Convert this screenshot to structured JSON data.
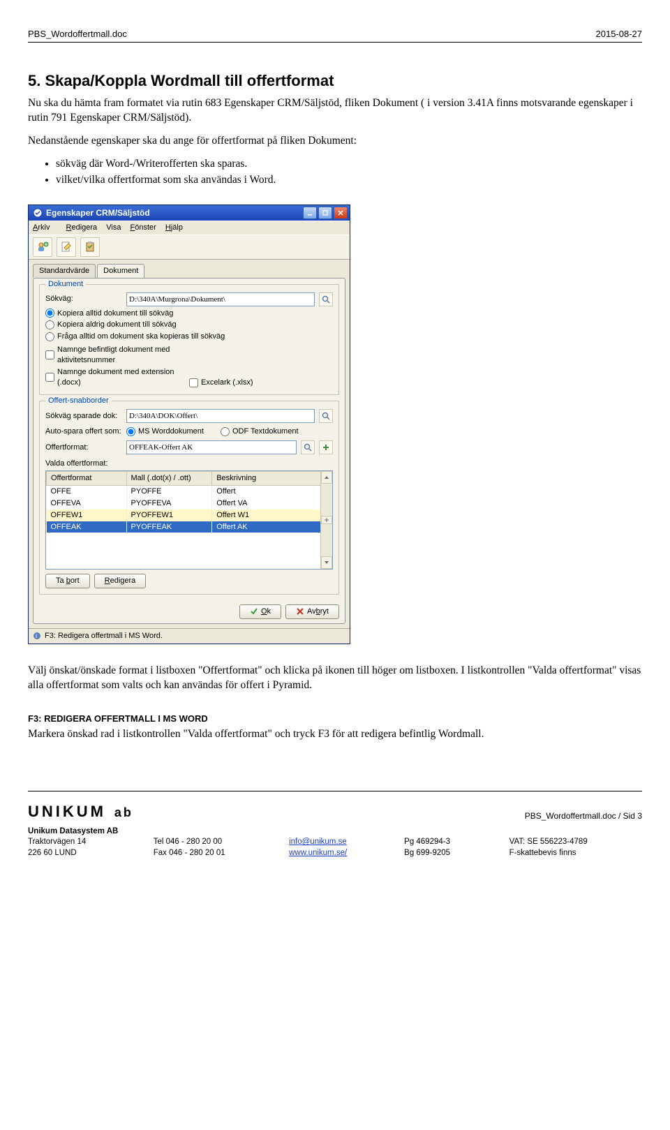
{
  "header": {
    "doc": "PBS_Wordoffertmall.doc",
    "date": "2015-08-27"
  },
  "section": {
    "title": "5. Skapa/Koppla Wordmall till offertformat",
    "p1": "Nu ska du hämta fram formatet via rutin 683 Egenskaper CRM/Säljstöd, fliken Dokument ( i version 3.41A finns motsvarande egenskaper i rutin 791 Egenskaper CRM/Säljstöd).",
    "p2": "Nedanstående egenskaper ska du ange för offertformat på fliken Dokument:",
    "b1": "sökväg där Word-/Writerofferten ska sparas.",
    "b2": "vilket/vilka offertformat som ska användas i Word."
  },
  "dlg": {
    "title": "Egenskaper CRM/Säljstöd",
    "menu": {
      "arkiv": "Arkiv",
      "redigera": "Redigera",
      "visa": "Visa",
      "fonster": "Fönster",
      "hjalp": "Hjälp"
    },
    "tabs": {
      "t1": "Standardvärde",
      "t2": "Dokument"
    },
    "fs1": {
      "legend": "Dokument",
      "sokvag_lbl": "Sökväg:",
      "sokvag_val": "D:\\340A\\Murgrona\\Dokument\\",
      "r1": "Kopiera alltid dokument till sökväg",
      "r2": "Kopiera aldrig dokument till sökväg",
      "r3": "Fråga alltid om dokument ska kopieras till sökväg",
      "c1": "Namnge befintligt dokument med aktivitetsnummer",
      "c2": "Namnge dokument med extension (.docx)",
      "c3": "Excelark (.xlsx)"
    },
    "fs2": {
      "legend": "Offert-snabborder",
      "sparade_lbl": "Sökväg sparade dok:",
      "sparade_val": "D:\\340A\\DOK\\Offert\\",
      "autospara_lbl": "Auto-spara offert som:",
      "rMs": "MS Worddokument",
      "rOdf": "ODF Textdokument",
      "offertformat_lbl": "Offertformat:",
      "offertformat_val": "OFFEAK-Offert AK",
      "valda_lbl": "Valda offertformat:",
      "th1": "Offertformat",
      "th2": "Mall (.dot(x) / .ott)",
      "th3": "Beskrivning",
      "rows": [
        {
          "a": "OFFE",
          "b": "PYOFFE",
          "c": "Offert"
        },
        {
          "a": "OFFEVA",
          "b": "PYOFFEVA",
          "c": "Offert VA"
        },
        {
          "a": "OFFEW1",
          "b": "PYOFFEW1",
          "c": "Offert W1"
        },
        {
          "a": "OFFEAK",
          "b": "PYOFFEAK",
          "c": "Offert AK"
        }
      ],
      "btn_tabort": "Ta bort",
      "btn_redigera": "Redigera"
    },
    "ok": "Ok",
    "avbryt": "Avbryt",
    "status": "F3: Redigera offertmall i MS Word."
  },
  "after": {
    "p1": "Välj önskat/önskade format i listboxen \"Offertformat\" och klicka på ikonen till höger om listboxen. I listkontrollen \"Valda offertformat\" visas alla offertformat som valts och kan användas för offert i Pyramid.",
    "h": "F3: REDIGERA OFFERTMALL I MS WORD",
    "p2": "Markera önskad rad i listkontrollen \"Valda offertformat\" och tryck F3 för att redigera befintlig Wordmall."
  },
  "footer": {
    "sid": "PBS_Wordoffertmall.doc / Sid 3",
    "company": "Unikum Datasystem AB",
    "addr1": "Traktorvägen 14",
    "addr2": "226 60  LUND",
    "tel": "Tel  046 - 280 20 00",
    "fax": "Fax  046 - 280 20 01",
    "email": "info@unikum.se",
    "web": "www.unikum.se/",
    "pg": "Pg  469294-3",
    "bg": "Bg  699-9205",
    "vat": "VAT: SE 556223-4789",
    "fsk": "F-skattebevis finns",
    "logo": "UNIKUM",
    "logo2": "ab"
  }
}
